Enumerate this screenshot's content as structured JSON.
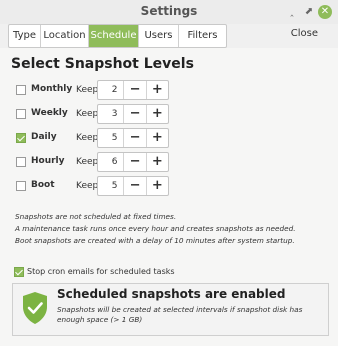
{
  "window": {
    "title": "Settings",
    "controls": {
      "minimize": "‸",
      "maximize": "⬈",
      "close": "✕"
    }
  },
  "tabs": [
    {
      "label": "Type",
      "active": false
    },
    {
      "label": "Location",
      "active": false
    },
    {
      "label": "Schedule",
      "active": true
    },
    {
      "label": "Users",
      "active": false
    },
    {
      "label": "Filters",
      "active": false
    }
  ],
  "close_label": "Close",
  "heading": "Select Snapshot Levels",
  "keep_label": "Keep",
  "levels": [
    {
      "label": "Monthly",
      "checked": false,
      "keep": "2"
    },
    {
      "label": "Weekly",
      "checked": false,
      "keep": "3"
    },
    {
      "label": "Daily",
      "checked": true,
      "keep": "5"
    },
    {
      "label": "Hourly",
      "checked": false,
      "keep": "6"
    },
    {
      "label": "Boot",
      "checked": false,
      "keep": "5"
    }
  ],
  "spin_symbols": {
    "minus": "−",
    "plus": "+"
  },
  "notes": [
    "Snapshots are not scheduled at fixed times.",
    "A maintenance task runs once every hour and creates snapshots as needed.",
    "Boot snapshots are created with a delay of 10 minutes after system startup."
  ],
  "cron": {
    "label": "Stop cron emails for scheduled tasks",
    "checked": true
  },
  "info": {
    "title": "Scheduled snapshots are enabled",
    "text": "Snapshots will be created at selected intervals if snapshot disk has enough space (> 1 GB)",
    "icon": "shield-check-icon"
  },
  "colors": {
    "accent": "#8fbc5a",
    "shield": "#7cb342"
  }
}
